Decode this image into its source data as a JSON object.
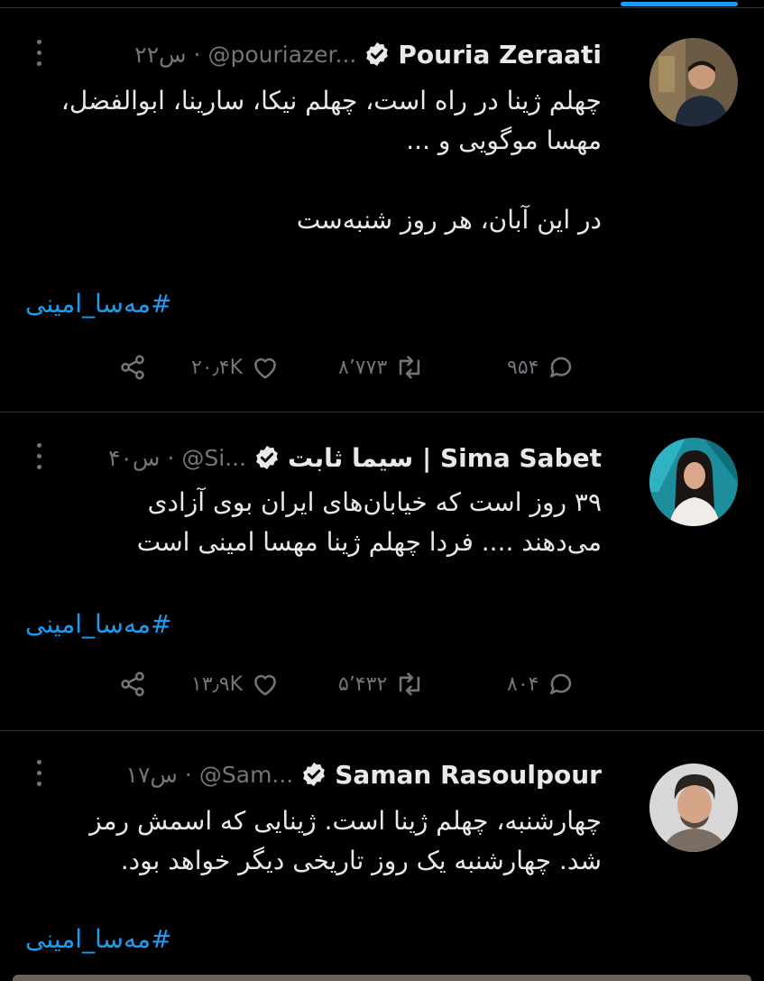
{
  "tweets": [
    {
      "name": "Pouria Zeraati",
      "handle": "@pouriazer...",
      "time": "۲۲س",
      "separator": "·",
      "text": "چهلم ژینا در راه است، چهلم نیکا، سارینا، ابوالفضل،\nمهسا موگویی و ...\n\nدر این آبان، هر روز شنبه‌ست",
      "hashtag": "#مه‌سا_امینی",
      "replies": "۹۵۴",
      "retweets": "۸٬۷۷۳",
      "likes": "۲۰٫۴K"
    },
    {
      "name": "Sima Sabet | سیما ثابت",
      "handle": "@Si...",
      "time": "۴۰س",
      "separator": "·",
      "text": "۳۹ روز است که خیابان‌های ایران بوی آزادی\nمی‌دهند .... فردا چهلم ژینا مهسا امینی است",
      "hashtag": "#مه‌سا_امینی",
      "replies": "۸۰۴",
      "retweets": "۵٬۴۳۲",
      "likes": "۱۳٫۹K"
    },
    {
      "name": "Saman Rasoulpour",
      "handle": "@Sam...",
      "time": "۱۷س",
      "separator": "·",
      "text": "چهارشنبه، چهلم ژینا است. ژینایی که اسمش رمز\nشد. چهارشنبه یک روز تاریخی دیگر خواهد بود.",
      "hashtag": "#مه‌سا_امینی"
    }
  ],
  "colors": {
    "background": "#000000",
    "text": "#e7e9ea",
    "muted": "#71767b",
    "accent": "#1d9bf0",
    "divider": "#2f3336"
  }
}
